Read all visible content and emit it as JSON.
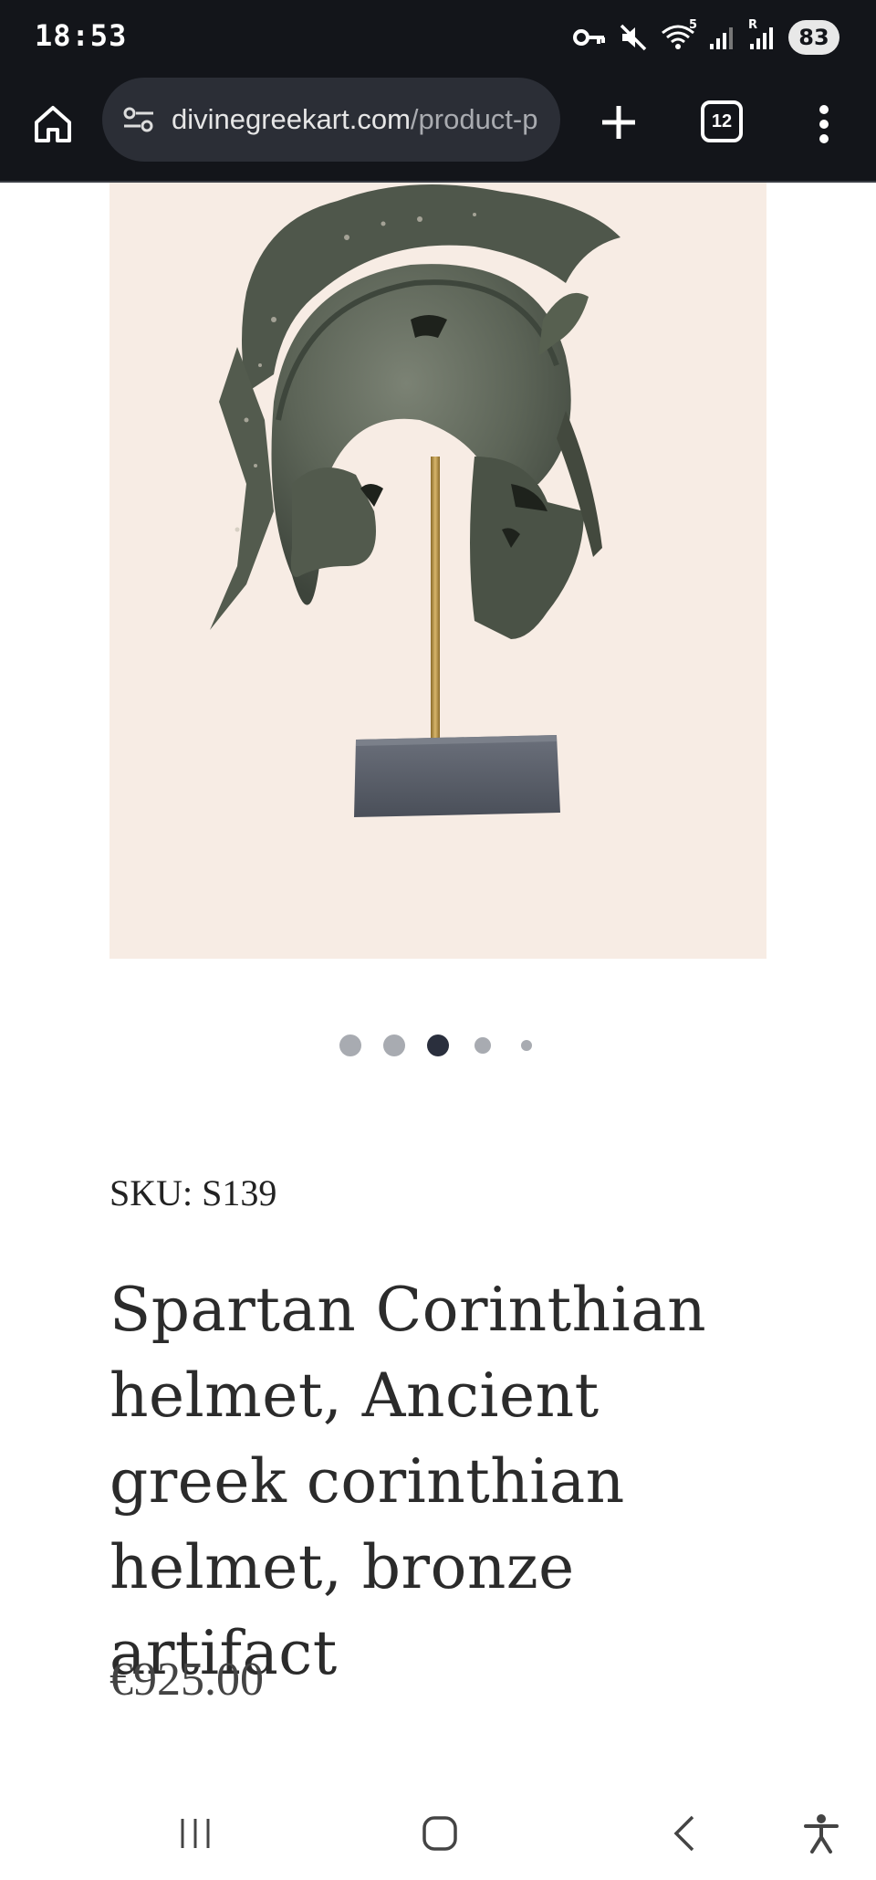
{
  "status_bar": {
    "time": "18:53",
    "wifi_label": "5",
    "signal_label": "R",
    "battery": "83"
  },
  "browser": {
    "url_domain": "divinegreekart.com",
    "url_path": "/product-p",
    "tab_count": "12"
  },
  "carousel": {
    "total": 5,
    "active_index": 2
  },
  "product": {
    "image_alt": "Spartan Corinthian bronze helmet on stand",
    "sku": "SKU: S139",
    "title": "Spartan Corinthian helmet, Ancient greek corinthian helmet, bronze artifact",
    "price": "€925.00"
  },
  "colors": {
    "browser_bar": "#13151a",
    "image_bg": "#f7ece4",
    "dot_active": "#2a2f3d",
    "dot_inactive": "#a8abb1"
  },
  "icons": [
    "key-icon",
    "mute-icon",
    "wifi-icon",
    "signal-icon",
    "home-icon",
    "site-settings-icon",
    "plus-icon",
    "tabs-icon",
    "menu-icon",
    "recents-icon",
    "home-nav-icon",
    "back-icon",
    "accessibility-icon"
  ]
}
